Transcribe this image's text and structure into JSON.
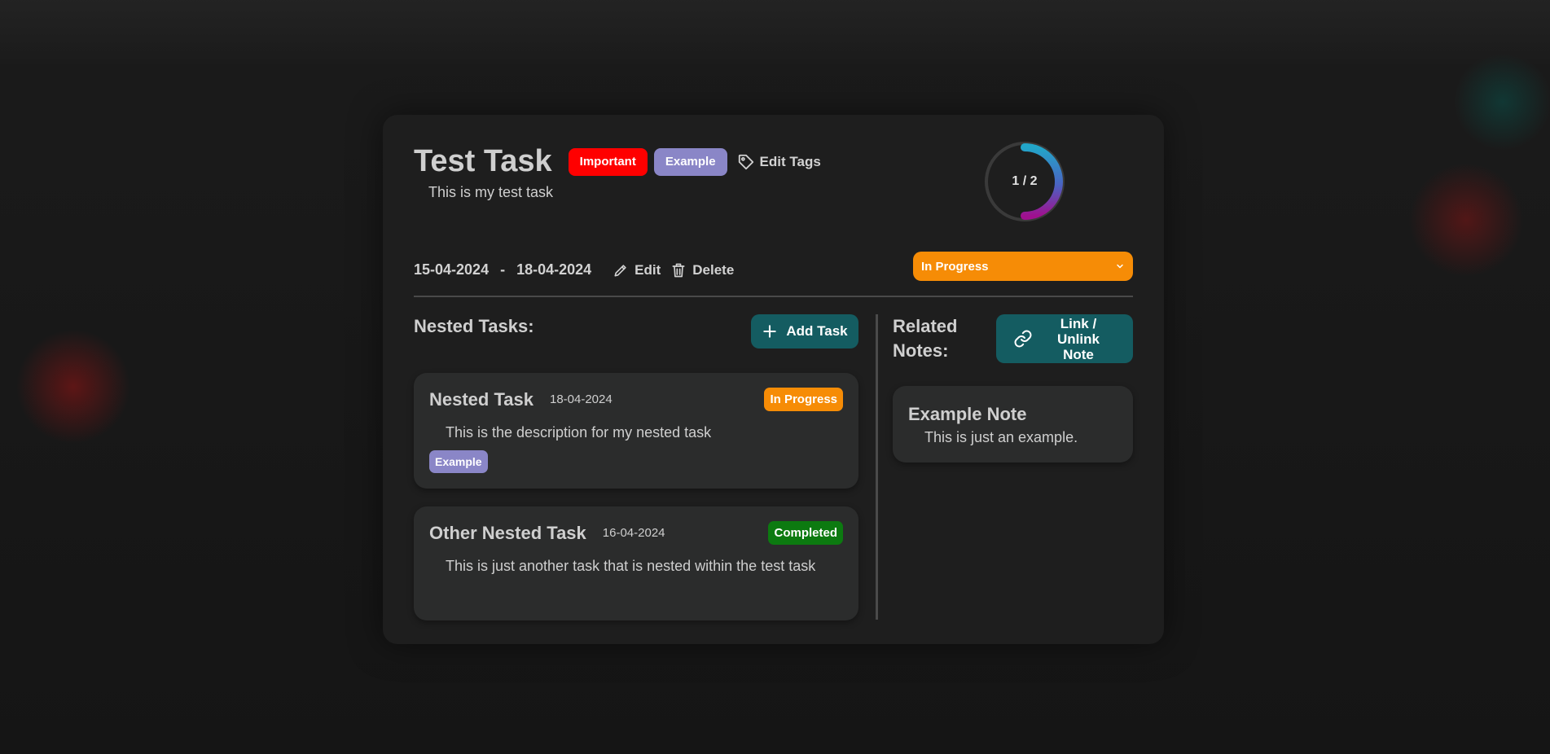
{
  "task": {
    "title": "Test Task",
    "description": "This is my test task",
    "tags": [
      {
        "label": "Important",
        "color": "#ff0000"
      },
      {
        "label": "Example",
        "color": "#8a86c7"
      }
    ],
    "edit_tags_label": "Edit Tags",
    "start_date": "15-04-2024",
    "date_separator": "-",
    "end_date": "18-04-2024",
    "edit_label": "Edit",
    "delete_label": "Delete",
    "status": "In Progress",
    "status_color": "#f68c06"
  },
  "progress": {
    "label": "1 / 2",
    "completed": 1,
    "total": 2
  },
  "nested_tasks": {
    "heading": "Nested Tasks:",
    "add_label": "Add Task",
    "items": [
      {
        "title": "Nested Task",
        "date": "18-04-2024",
        "status": "In Progress",
        "status_color": "#f68c06",
        "description": "This is the description for my nested task",
        "tag": "Example"
      },
      {
        "title": "Other Nested Task",
        "date": "16-04-2024",
        "status": "Completed",
        "status_color": "#0c7a10",
        "description": "This is just another task that is nested within the test task"
      }
    ]
  },
  "related_notes": {
    "heading": "Related Notes:",
    "link_label": "Link / Unlink Note",
    "items": [
      {
        "title": "Example Note",
        "text": "This is just an example."
      }
    ]
  },
  "colors": {
    "accent_teal": "#145c61",
    "background": "#1e1e1e",
    "card": "#2b2c2c"
  }
}
